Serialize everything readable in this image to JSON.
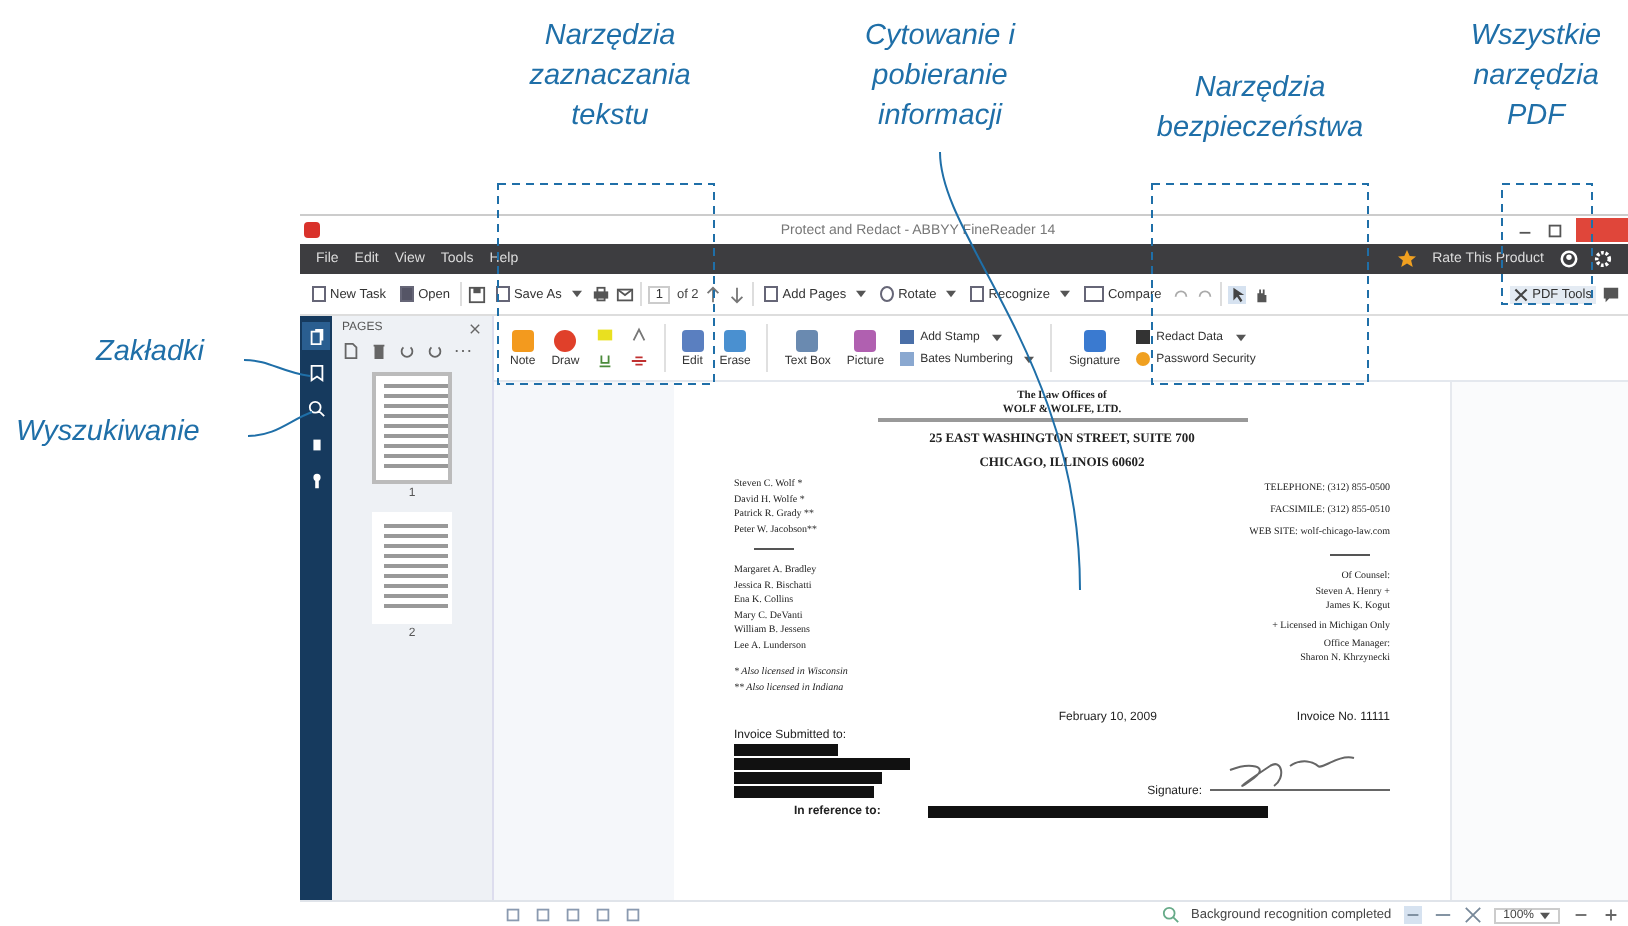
{
  "callouts": {
    "top": [
      {
        "text": "Narzędzia zaznaczania tekstu"
      },
      {
        "text": "Cytowanie i pobieranie informacji"
      },
      {
        "text": "Narzędzia bezpieczeństwa"
      },
      {
        "text": "Wszystkie narzędzia PDF"
      }
    ],
    "left": [
      "Zakładki",
      "Wyszukiwanie"
    ]
  },
  "window": {
    "title": "Protect and Redact - ABBYY FineReader 14"
  },
  "menu": [
    "File",
    "Edit",
    "View",
    "Tools",
    "Help"
  ],
  "rate": "Rate This Product",
  "toolbar": {
    "new_task": "New Task",
    "open": "Open",
    "save_as": "Save As",
    "page": "1",
    "page_count": "of 2",
    "add_pages": "Add Pages",
    "rotate": "Rotate",
    "recognize": "Recognize",
    "compare": "Compare",
    "pdf_tools": "PDF Tools"
  },
  "nav_tabs": [
    {
      "selected": true
    },
    {
      "selected": false
    },
    {
      "selected": false
    },
    {
      "selected": false
    },
    {
      "selected": false
    }
  ],
  "pages": {
    "title": "PAGES",
    "thumbnails": [
      {
        "label": "1",
        "selected": true
      },
      {
        "label": "2",
        "selected": false
      }
    ]
  },
  "ribbon": {
    "note": "Note",
    "draw": "Draw",
    "edit": "Edit",
    "erase": "Erase",
    "text_box": "Text Box",
    "picture": "Picture",
    "add_stamp": "Add Stamp",
    "bates_numbering": "Bates Numbering",
    "signature": "Signature",
    "redact_data": "Redact Data",
    "password_security": "Password Security"
  },
  "document": {
    "letterhead": [
      "The Law Offices of",
      "WOLF & WOLFE, LTD.",
      "25 EAST WASHINGTON STREET, SUITE 700",
      "CHICAGO, ILLINOIS 60602"
    ],
    "partners": [
      "Steven C. Wolf *",
      "David H. Wolfe *",
      "Patrick R. Grady **",
      "Peter W. Jacobson**"
    ],
    "associates": [
      "Margaret A. Bradley",
      "Jessica R. Bischatti",
      "Ena K. Collins",
      "Mary C. DeVanti",
      "William B. Jessens",
      "Lee A. Lunderson"
    ],
    "contacts": [
      "TELEPHONE: (312) 855-0500",
      "FACSIMILE: (312) 855-0510",
      "WEB SITE: wolf-chicago-law.com"
    ],
    "counsel": [
      "Of Counsel:",
      "Steven A. Henry +",
      "James K. Kogut"
    ],
    "licensed_note": "+ Licensed in Michigan Only",
    "manager": [
      "Office Manager:",
      "Sharon N. Khrzynecki"
    ],
    "footnotes": [
      "*  Also licensed in Wisconsin",
      "** Also licensed in Indiana"
    ],
    "date": "February 10, 2009",
    "invoice_no": "Invoice No. 11111",
    "submitted_to": "Invoice Submitted to:",
    "signature": "Signature:",
    "reference": "In reference to:"
  },
  "status": {
    "message": "Background recognition completed",
    "zoom": "100%"
  }
}
